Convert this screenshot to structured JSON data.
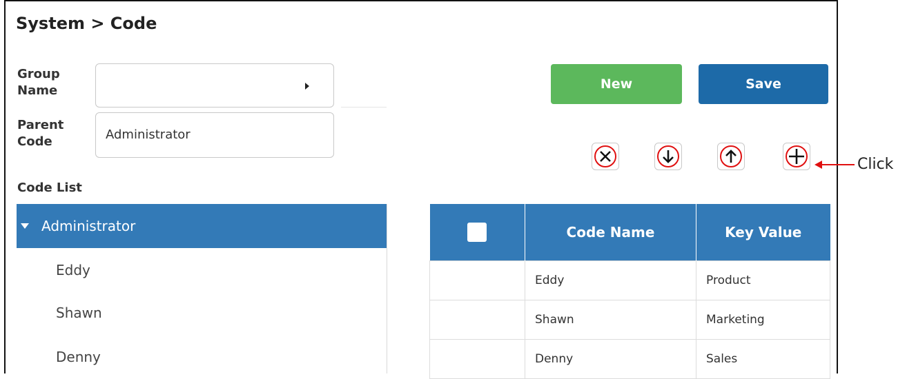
{
  "breadcrumb": "System > Code",
  "form": {
    "group_name_label": "Group\nName",
    "group_name_value": "",
    "parent_code_label": "Parent\nCode",
    "parent_code_value": "Administrator"
  },
  "buttons": {
    "new_label": "New",
    "save_label": "Save",
    "new_color": "#5cb85c",
    "save_color": "#1d6aa8"
  },
  "toolbar_icons": [
    "delete-icon",
    "move-down-icon",
    "move-up-icon",
    "add-icon"
  ],
  "annotation": {
    "label": "Click",
    "color": "#e01010"
  },
  "code_list": {
    "title": "Code List",
    "root": "Administrator",
    "children": [
      "Eddy",
      "Shawn",
      "Denny"
    ]
  },
  "grid": {
    "columns": [
      "",
      "Code Name",
      "Key Value"
    ],
    "rows": [
      {
        "code_name": "Eddy",
        "key_value": "Product"
      },
      {
        "code_name": "Shawn",
        "key_value": "Marketing"
      },
      {
        "code_name": "Denny",
        "key_value": "Sales"
      }
    ]
  },
  "colors": {
    "accent_blue": "#337ab7"
  }
}
